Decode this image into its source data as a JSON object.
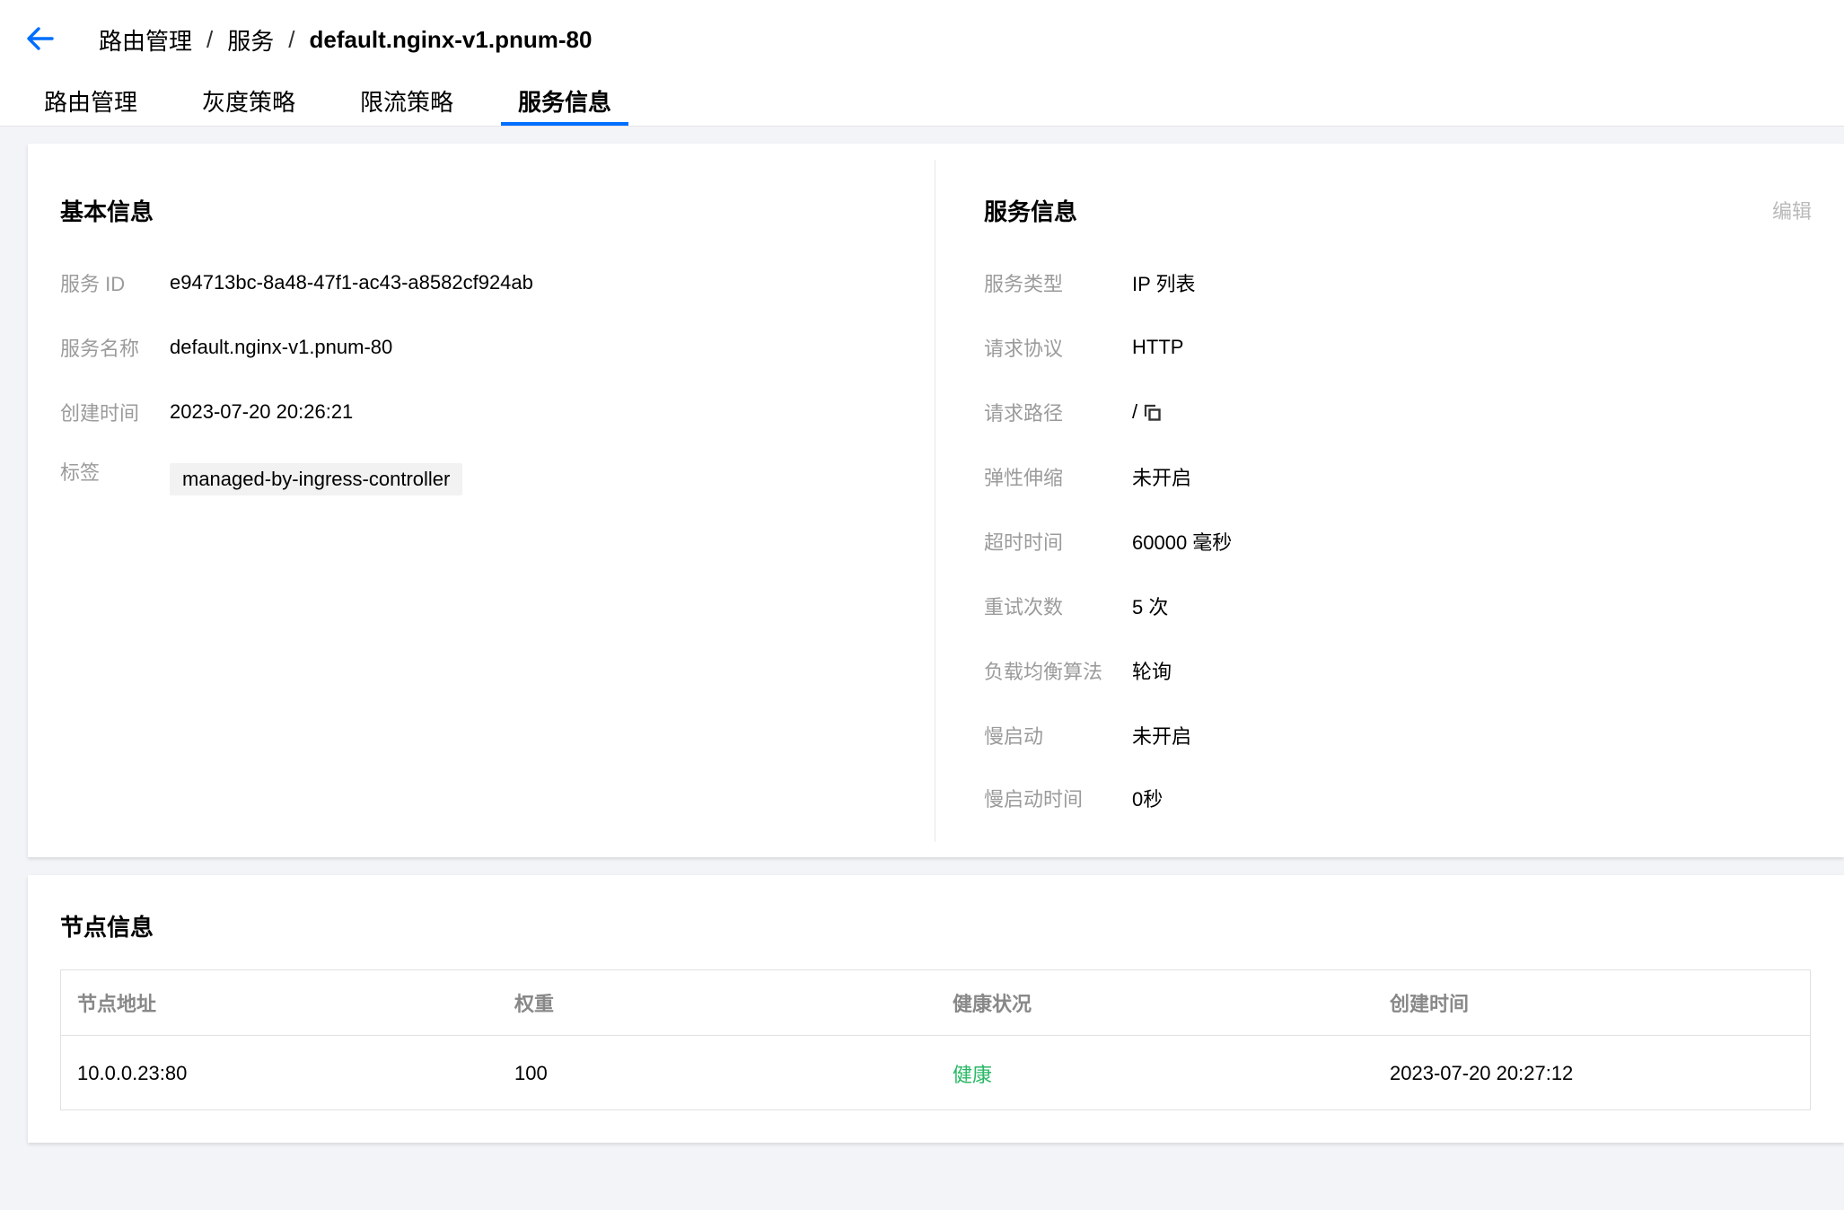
{
  "header": {
    "breadcrumb": [
      "路由管理",
      "服务",
      "default.nginx-v1.pnum-80"
    ],
    "separator": "/",
    "tabs": [
      {
        "label": "路由管理",
        "active": false
      },
      {
        "label": "灰度策略",
        "active": false
      },
      {
        "label": "限流策略",
        "active": false
      },
      {
        "label": "服务信息",
        "active": true
      }
    ]
  },
  "basic_info": {
    "title": "基本信息",
    "fields": [
      {
        "label": "服务 ID",
        "value": "e94713bc-8a48-47f1-ac43-a8582cf924ab"
      },
      {
        "label": "服务名称",
        "value": "default.nginx-v1.pnum-80"
      },
      {
        "label": "创建时间",
        "value": "2023-07-20 20:26:21"
      }
    ],
    "tag_label": "标签",
    "tags": [
      "managed-by-ingress-controller"
    ]
  },
  "service_info": {
    "title": "服务信息",
    "edit_label": "编辑",
    "fields": [
      {
        "label": "服务类型",
        "value": "IP 列表"
      },
      {
        "label": "请求协议",
        "value": "HTTP"
      },
      {
        "label": "请求路径",
        "value": "/"
      },
      {
        "label": "弹性伸缩",
        "value": "未开启"
      },
      {
        "label": "超时时间",
        "value": "60000 毫秒"
      },
      {
        "label": "重试次数",
        "value": "5 次"
      },
      {
        "label": "负载均衡算法",
        "value": "轮询"
      },
      {
        "label": "慢启动",
        "value": "未开启"
      },
      {
        "label": "慢启动时间",
        "value": "0秒"
      }
    ]
  },
  "nodes": {
    "title": "节点信息",
    "columns": [
      "节点地址",
      "权重",
      "健康状况",
      "创建时间"
    ],
    "rows": [
      {
        "address": "10.0.0.23:80",
        "weight": "100",
        "health": "健康",
        "created": "2023-07-20 20:27:12"
      }
    ]
  },
  "colors": {
    "accent": "#006eff",
    "healthy": "#29b865",
    "label_gray": "#9b9b9b"
  },
  "icons": {
    "back": "arrow-left-icon",
    "copy": "copy-icon"
  }
}
